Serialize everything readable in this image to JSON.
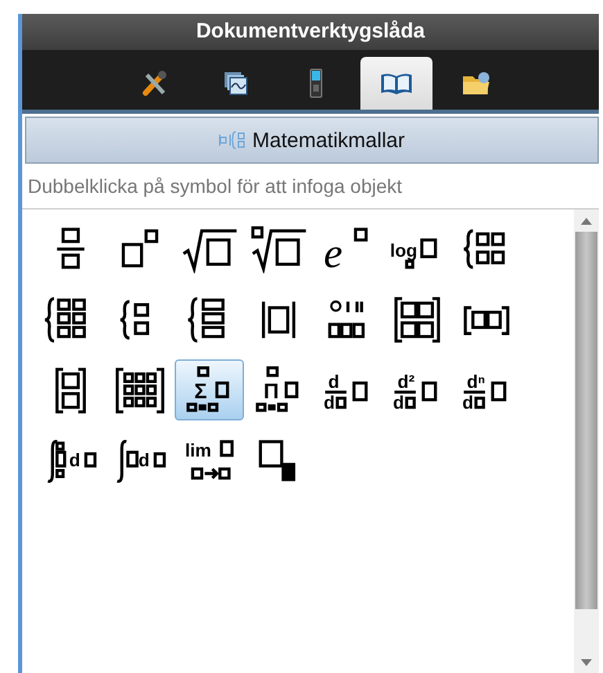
{
  "window": {
    "title": "Dokumentverktygslåda"
  },
  "tabs": [
    {
      "kind": "tools",
      "selected": false
    },
    {
      "kind": "pages",
      "selected": false
    },
    {
      "kind": "handheld",
      "selected": false
    },
    {
      "kind": "book",
      "selected": true
    },
    {
      "kind": "folder",
      "selected": false
    }
  ],
  "section": {
    "title": "Matematikmallar"
  },
  "hint": "Dubbelklicka på symbol för att infoga objekt",
  "templates": [
    {
      "kind": "fraction",
      "selected": false
    },
    {
      "kind": "power",
      "selected": false
    },
    {
      "kind": "square-root",
      "selected": false
    },
    {
      "kind": "nth-root",
      "selected": false
    },
    {
      "kind": "exponential",
      "texts": [
        "e"
      ],
      "selected": false
    },
    {
      "kind": "logarithm",
      "texts": [
        "log"
      ],
      "selected": false
    },
    {
      "kind": "piecewise-two",
      "selected": false
    },
    {
      "kind": "piecewise-three",
      "selected": false
    },
    {
      "kind": "system-two",
      "selected": false
    },
    {
      "kind": "system-three",
      "selected": false
    },
    {
      "kind": "absolute-value",
      "selected": false
    },
    {
      "kind": "degrees-minutes-seconds",
      "selected": false
    },
    {
      "kind": "matrix-two-by-two",
      "selected": false
    },
    {
      "kind": "matrix-one-by-two",
      "selected": false
    },
    {
      "kind": "matrix-two-by-one",
      "selected": false
    },
    {
      "kind": "matrix-m-by-n",
      "selected": false
    },
    {
      "kind": "sum",
      "texts": [
        "Σ"
      ],
      "selected": true
    },
    {
      "kind": "product",
      "texts": [
        "Π"
      ],
      "selected": false
    },
    {
      "kind": "derivative",
      "texts": [
        "d",
        "d"
      ],
      "selected": false
    },
    {
      "kind": "second-derivative",
      "texts": [
        "d²",
        "d"
      ],
      "selected": false
    },
    {
      "kind": "nth-derivative",
      "texts": [
        "dⁿ",
        "d"
      ],
      "selected": false
    },
    {
      "kind": "definite-integral",
      "texts": [
        "d"
      ],
      "selected": false
    },
    {
      "kind": "indefinite-integral",
      "texts": [
        "d"
      ],
      "selected": false
    },
    {
      "kind": "limit",
      "texts": [
        "lim"
      ],
      "selected": false
    },
    {
      "kind": "subscript",
      "selected": false
    }
  ]
}
